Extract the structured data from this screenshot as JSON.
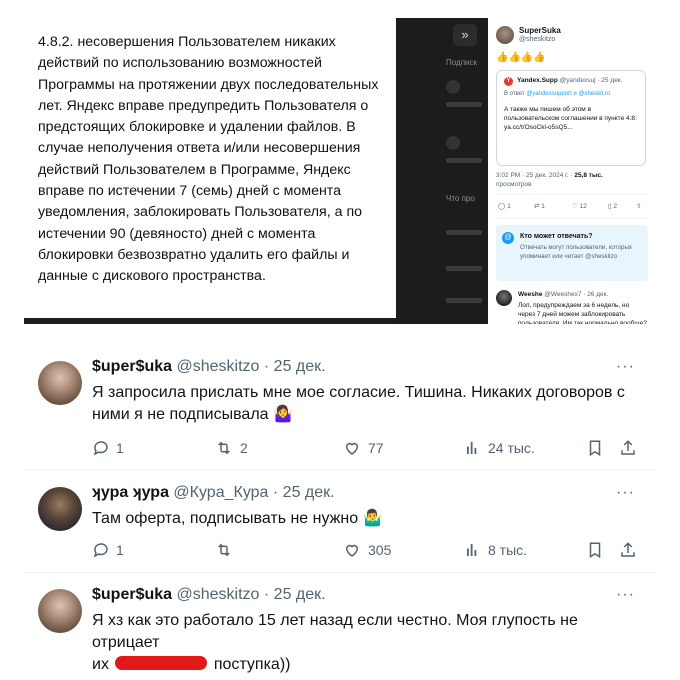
{
  "legal": {
    "text": "4.8.2. несовершения Пользователем никаких действий по использованию возможностей Программы на протяжении двух последовательных лет. Яндекс вправе предупредить Пользователя о предстоящих блокировке и удалении файлов. В случае неполучения ответа и/или несовершения действий Пользователем в Программе, Яндекс вправе по истечении 7 (семь) дней с момента уведомления, заблокировать Пользователя, а по истечении 90 (девяносто) дней с момента блокировки безвозвратно удалить его файлы и данные с дискового пространства."
  },
  "dark_panel": {
    "button_glyph": "»",
    "label_1": "Подписк",
    "label_2": "Что про"
  },
  "phone_tweet": {
    "author_name": "SuperSuka",
    "author_handle": "@sheskitzo",
    "emojis": "👍👍👍👍",
    "quote": {
      "logo": "Y",
      "name": "Yandex.Supp",
      "handle_date": "@yandexsuj · 25 дек.",
      "reply_prefix": "В ответ",
      "reply_to": "@yandexsupport и @sheskit.ro",
      "body": "А также мы пишем об этом в пользовательском соглашении в пункте 4.8: ya.cc/t/OsoCkl-o5sQ5..."
    },
    "meta_time": "3:02 PM · 25 дек. 2024 г. ·",
    "meta_views": "25,8 тыс.",
    "meta_views_label": "просмотров",
    "actions": {
      "replies": "1",
      "retweets": "1",
      "likes": "12",
      "bookmarks": "2"
    },
    "who_can_reply": {
      "title": "Кто может отвечать?",
      "text": "Отвечать могут пользователи, которых упоминает или читает @sheskitzo"
    },
    "reply": {
      "name": "Weeshe",
      "handle_date": "@Weeshex7 · 26 дек.",
      "body": "Лол, предупреждаем за 6 недель, но через 7 дней можем заблокировать пользователя. Им так нормально вообще?"
    }
  },
  "tweets": [
    {
      "name": "$uper$uka",
      "handle": "@sheskitzo",
      "date": "· 25 дек.",
      "text": "Я запросила прислать мне мое согласие. Тишина. Никаких договоров с ними я не подписывала 🤷‍♀️",
      "replies": "1",
      "retweets": "2",
      "likes": "77",
      "views": "24 тыс."
    },
    {
      "name": "ʞура ʞура",
      "handle": "@Кура_Кура",
      "date": "· 25 дек.",
      "text": "Там оферта, подписывать не нужно 🤷‍♂️",
      "replies": "1",
      "retweets": "",
      "likes": "305",
      "views": "8 тыс."
    },
    {
      "name": "$uper$uka",
      "handle": "@sheskitzo",
      "date": "· 25 дек.",
      "text_part1": "Я хз как это работало 15 лет назад если честно. Моя глупость не отрицает",
      "text_part2_prefix": "их",
      "text_part2_suffix": "поступка))"
    }
  ],
  "dots": "···"
}
